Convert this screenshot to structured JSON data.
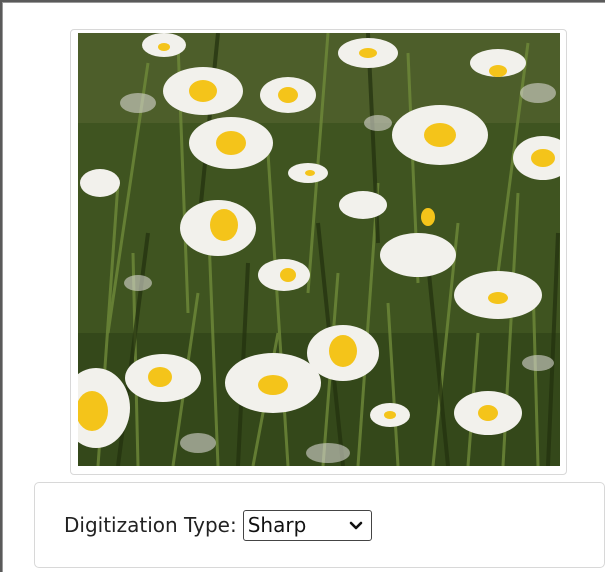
{
  "photo": {
    "icon": "daisy-field-photo",
    "colors": {
      "grass_dark": "#2f3f18",
      "grass": "#4f6a26",
      "petal": "#f3f2ee",
      "center": "#f2c21b"
    }
  },
  "controls": {
    "digitization_label": "Digitization Type:",
    "digitization_value": "Sharp",
    "chevron_icon": "chevron-down-icon"
  }
}
